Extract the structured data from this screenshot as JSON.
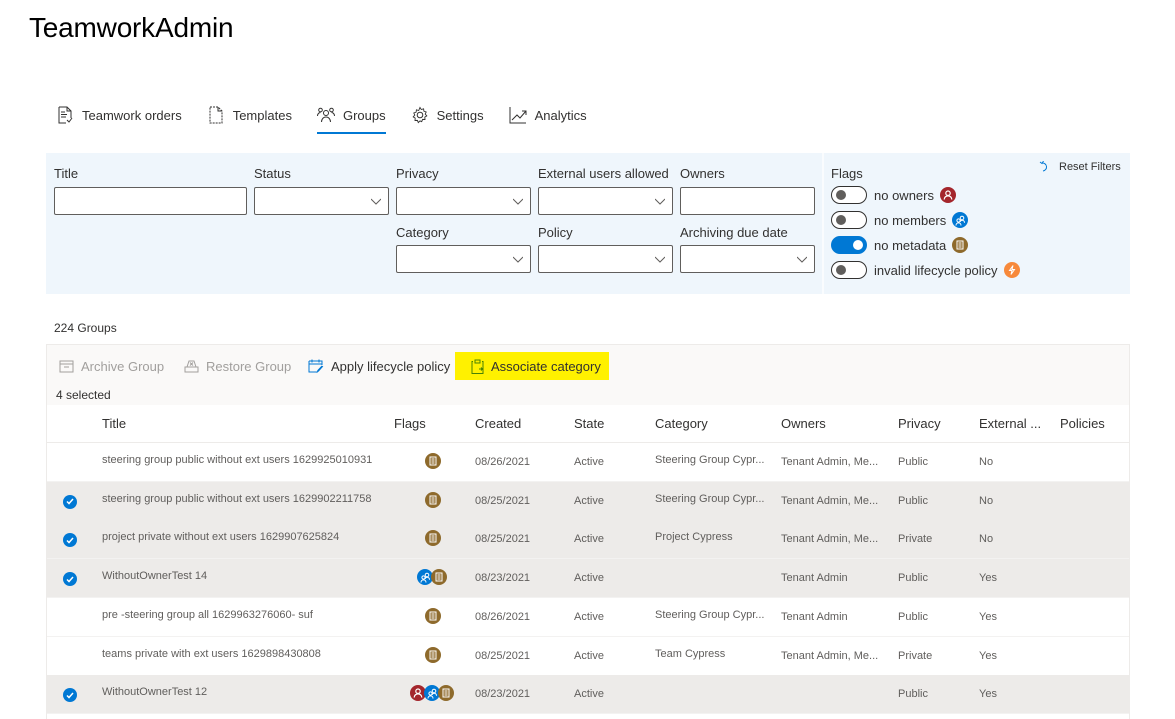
{
  "app": {
    "title": "TeamworkAdmin"
  },
  "tabs": [
    {
      "label": "Teamwork orders",
      "icon": "document-check-icon",
      "active": false
    },
    {
      "label": "Templates",
      "icon": "page-icon",
      "active": false
    },
    {
      "label": "Groups",
      "icon": "people-group-icon",
      "active": true
    },
    {
      "label": "Settings",
      "icon": "gear-icon",
      "active": false
    },
    {
      "label": "Analytics",
      "icon": "line-chart-icon",
      "active": false
    }
  ],
  "filters": {
    "title": {
      "label": "Title",
      "value": ""
    },
    "status": {
      "label": "Status",
      "value": ""
    },
    "privacy": {
      "label": "Privacy",
      "value": ""
    },
    "external_users": {
      "label": "External users allowed",
      "value": ""
    },
    "owners": {
      "label": "Owners",
      "value": ""
    },
    "category": {
      "label": "Category",
      "value": ""
    },
    "policy": {
      "label": "Policy",
      "value": ""
    },
    "archiving_due": {
      "label": "Archiving due date",
      "value": ""
    },
    "flags_label": "Flags",
    "reset_label": "Reset Filters",
    "flags": [
      {
        "label": "no owners",
        "on": false,
        "icon": "no-owners-icon",
        "color": "#a4262c"
      },
      {
        "label": "no members",
        "on": false,
        "icon": "no-members-icon",
        "color": "#0078d4"
      },
      {
        "label": "no metadata",
        "on": true,
        "icon": "no-metadata-icon",
        "color": "#8e6a2c"
      },
      {
        "label": "invalid lifecycle policy",
        "on": false,
        "icon": "invalid-policy-icon",
        "color": "#f7893b"
      }
    ]
  },
  "summary": {
    "count_label": "224 Groups",
    "selected_label": "4 selected"
  },
  "commands": {
    "archive": "Archive Group",
    "restore": "Restore Group",
    "apply_policy": "Apply lifecycle policy",
    "associate_category": "Associate category"
  },
  "table": {
    "columns": [
      "Title",
      "Flags",
      "Created",
      "State",
      "Category",
      "Owners",
      "Privacy",
      "External ...",
      "Policies"
    ],
    "rows": [
      {
        "selected": false,
        "title": "steering group public without ext users 1629925010931",
        "flags": [
          "no-metadata"
        ],
        "created": "08/26/2021",
        "state": "Active",
        "category": "Steering Group Cypr...",
        "owners": "Tenant Admin, Me...",
        "privacy": "Public",
        "external": "No",
        "policies": ""
      },
      {
        "selected": true,
        "title": "steering group public without ext users 1629902211758",
        "flags": [
          "no-metadata"
        ],
        "created": "08/25/2021",
        "state": "Active",
        "category": "Steering Group Cypr...",
        "owners": "Tenant Admin, Me...",
        "privacy": "Public",
        "external": "No",
        "policies": ""
      },
      {
        "selected": true,
        "title": "project private without ext users 1629907625824",
        "flags": [
          "no-metadata"
        ],
        "created": "08/25/2021",
        "state": "Active",
        "category": "Project Cypress",
        "owners": "Tenant Admin, Me...",
        "privacy": "Private",
        "external": "No",
        "policies": ""
      },
      {
        "selected": true,
        "title": "WithoutOwnerTest 14",
        "flags": [
          "no-members",
          "no-metadata"
        ],
        "created": "08/23/2021",
        "state": "Active",
        "category": "",
        "owners": "Tenant Admin",
        "privacy": "Public",
        "external": "Yes",
        "policies": ""
      },
      {
        "selected": false,
        "title": "pre -steering group all 1629963276060- suf",
        "flags": [
          "no-metadata"
        ],
        "created": "08/26/2021",
        "state": "Active",
        "category": "Steering Group Cypr...",
        "owners": "Tenant Admin",
        "privacy": "Public",
        "external": "Yes",
        "policies": ""
      },
      {
        "selected": false,
        "title": "teams private with ext users 1629898430808",
        "flags": [
          "no-metadata"
        ],
        "created": "08/25/2021",
        "state": "Active",
        "category": "Team Cypress",
        "owners": "Tenant Admin, Me...",
        "privacy": "Private",
        "external": "Yes",
        "policies": ""
      },
      {
        "selected": true,
        "title": "WithoutOwnerTest 12",
        "flags": [
          "no-owners",
          "no-members",
          "no-metadata"
        ],
        "created": "08/23/2021",
        "state": "Active",
        "category": "",
        "owners": "",
        "privacy": "Public",
        "external": "Yes",
        "policies": ""
      }
    ]
  },
  "colors": {
    "accent": "#0078d4",
    "highlight": "#fff100",
    "filter_bg": "#eff6fc",
    "no_owners": "#a4262c",
    "no_members": "#0078d4",
    "no_metadata": "#8e6a2c",
    "invalid_policy": "#f7893b"
  }
}
